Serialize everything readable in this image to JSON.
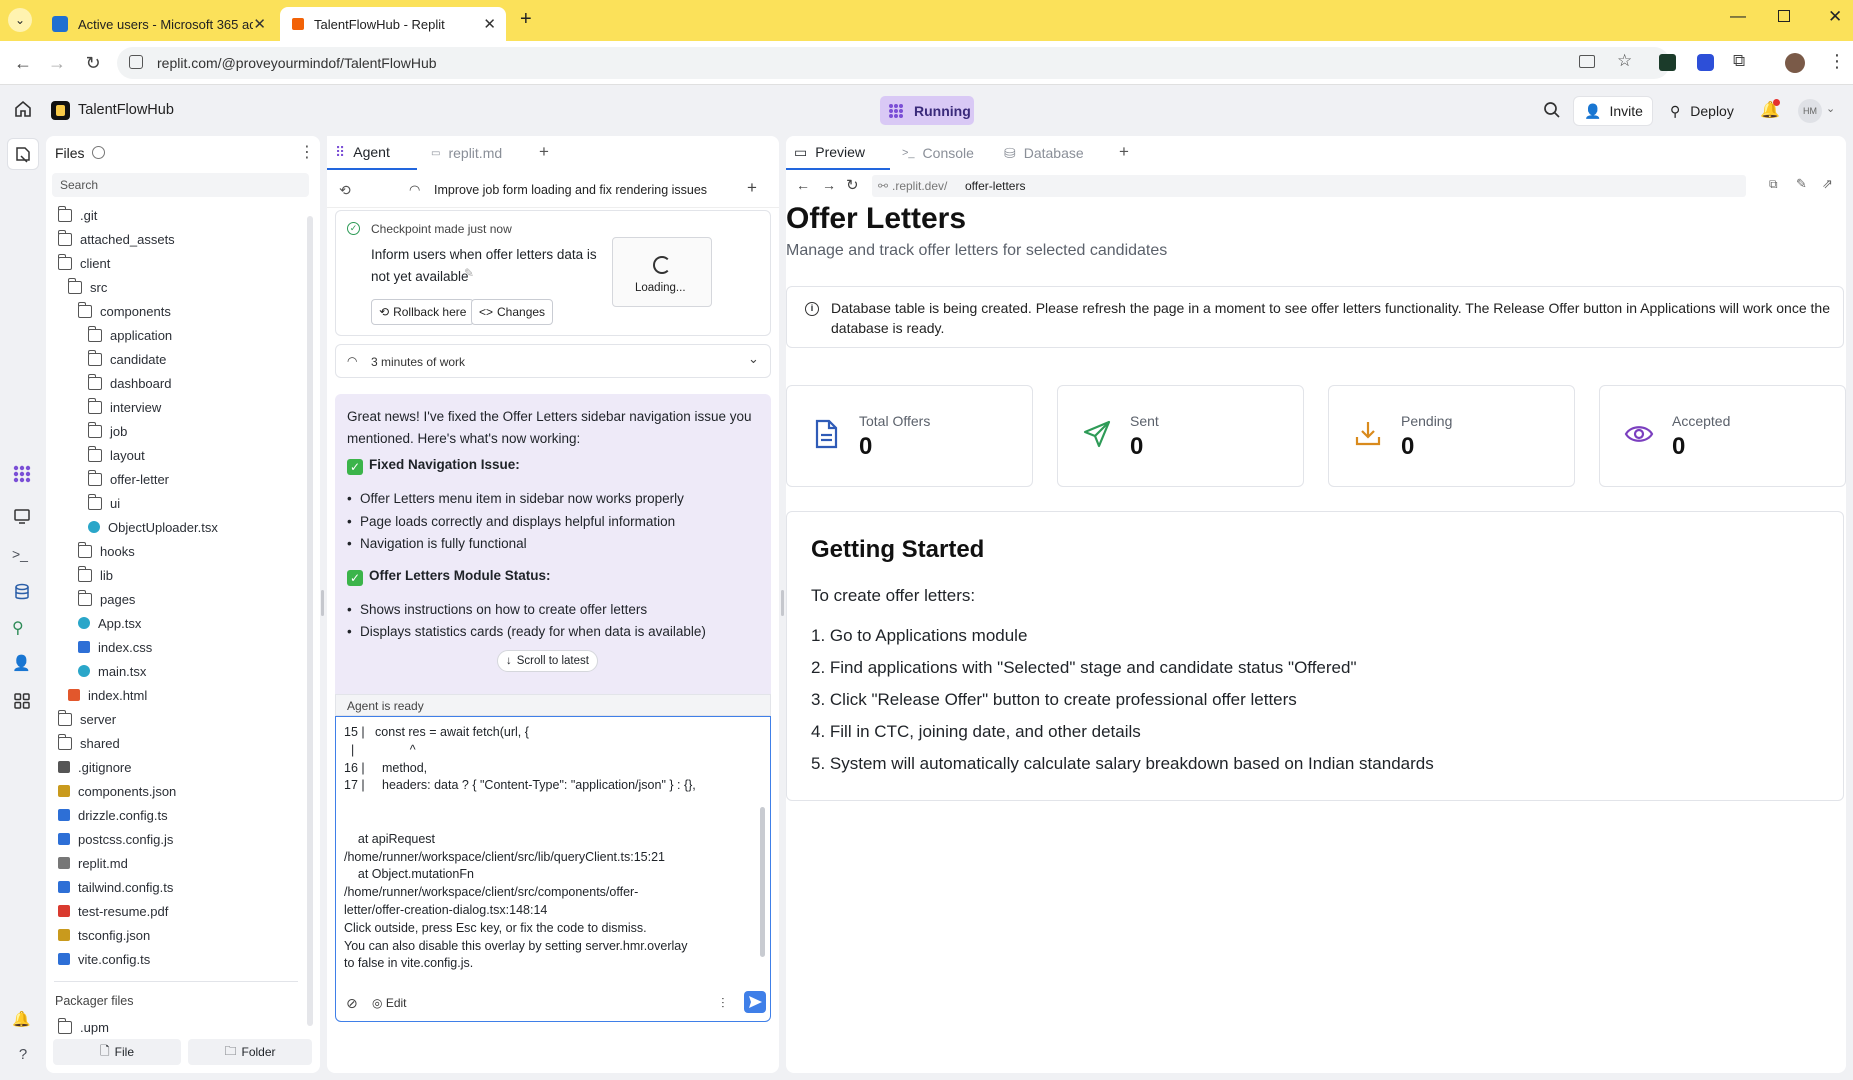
{
  "browser": {
    "tabs": [
      {
        "title": "Active users - Microsoft 365 ad",
        "active": false
      },
      {
        "title": "TalentFlowHub - Replit",
        "active": true
      }
    ],
    "url": "replit.com/@proveyourmindof/TalentFlowHub"
  },
  "header": {
    "project_name": "TalentFlowHub",
    "status": "Running",
    "invite_label": "Invite",
    "deploy_label": "Deploy",
    "avatar_initials": "HM"
  },
  "files": {
    "title": "Files",
    "search_placeholder": "Search",
    "tree": [
      {
        "name": ".git",
        "type": "folder",
        "depth": 0
      },
      {
        "name": "attached_assets",
        "type": "folder",
        "depth": 0
      },
      {
        "name": "client",
        "type": "folder",
        "depth": 0
      },
      {
        "name": "src",
        "type": "folder",
        "depth": 1
      },
      {
        "name": "components",
        "type": "folder",
        "depth": 2
      },
      {
        "name": "application",
        "type": "folder",
        "depth": 3
      },
      {
        "name": "candidate",
        "type": "folder",
        "depth": 3
      },
      {
        "name": "dashboard",
        "type": "folder",
        "depth": 3
      },
      {
        "name": "interview",
        "type": "folder",
        "depth": 3
      },
      {
        "name": "job",
        "type": "folder",
        "depth": 3
      },
      {
        "name": "layout",
        "type": "folder",
        "depth": 3
      },
      {
        "name": "offer-letter",
        "type": "folder",
        "depth": 3
      },
      {
        "name": "ui",
        "type": "folder",
        "depth": 3
      },
      {
        "name": "ObjectUploader.tsx",
        "type": "react",
        "depth": 3
      },
      {
        "name": "hooks",
        "type": "folder",
        "depth": 2
      },
      {
        "name": "lib",
        "type": "folder",
        "depth": 2
      },
      {
        "name": "pages",
        "type": "folder",
        "depth": 2
      },
      {
        "name": "App.tsx",
        "type": "react",
        "depth": 2
      },
      {
        "name": "index.css",
        "type": "css",
        "depth": 2
      },
      {
        "name": "main.tsx",
        "type": "react",
        "depth": 2
      },
      {
        "name": "index.html",
        "type": "html",
        "depth": 1
      },
      {
        "name": "server",
        "type": "folder",
        "depth": 0
      },
      {
        "name": "shared",
        "type": "folder",
        "depth": 0
      },
      {
        "name": ".gitignore",
        "type": "file",
        "depth": 0
      },
      {
        "name": "components.json",
        "type": "json",
        "depth": 0
      },
      {
        "name": "drizzle.config.ts",
        "type": "ts",
        "depth": 0
      },
      {
        "name": "postcss.config.js",
        "type": "js",
        "depth": 0
      },
      {
        "name": "replit.md",
        "type": "md",
        "depth": 0
      },
      {
        "name": "tailwind.config.ts",
        "type": "ts",
        "depth": 0
      },
      {
        "name": "test-resume.pdf",
        "type": "pdf",
        "depth": 0
      },
      {
        "name": "tsconfig.json",
        "type": "json",
        "depth": 0
      },
      {
        "name": "vite.config.ts",
        "type": "ts",
        "depth": 0
      }
    ],
    "packager_title": "Packager files",
    "packager_items": [
      ".upm"
    ],
    "new_file_label": "File",
    "new_folder_label": "Folder"
  },
  "agent": {
    "tabs": [
      "Agent",
      "replit.md"
    ],
    "task_title": "Improve job form loading and fix rendering issues",
    "checkpoint_label": "Checkpoint made just now",
    "checkpoint_text": "Inform users when offer letters data is not yet available",
    "loading_label": "Loading...",
    "rollback_label": "Rollback here",
    "changes_label": "Changes",
    "work_duration": "3 minutes of work",
    "message_intro": "Great news! I've fixed the Offer Letters sidebar navigation issue you mentioned. Here's what's now working:",
    "section1_title": "Fixed Navigation Issue:",
    "section1_items": [
      "Offer Letters menu item in sidebar now works properly",
      "Page loads correctly and displays helpful information",
      "Navigation is fully functional"
    ],
    "section2_title": "Offer Letters Module Status:",
    "section2_items": [
      "Shows instructions on how to create offer letters",
      "Displays statistics cards (ready for when data is available)"
    ],
    "scroll_to_latest": "Scroll to latest",
    "ready_status": "Agent is ready",
    "input_lines": [
      "15 |   const res = await fetch(url, {",
      "  |                ^",
      "16 |     method,",
      "17 |     headers: data ? { \"Content-Type\": \"application/json\" } : {},",
      "",
      "",
      "    at apiRequest",
      "/home/runner/workspace/client/src/lib/queryClient.ts:15:21",
      "    at Object.mutationFn",
      "/home/runner/workspace/client/src/components/offer-",
      "letter/offer-creation-dialog.tsx:148:14",
      "Click outside, press Esc key, or fix the code to dismiss.",
      "You can also disable this overlay by setting server.hmr.overlay",
      "to false in vite.config.js."
    ],
    "edit_label": "Edit"
  },
  "preview": {
    "tabs": [
      "Preview",
      "Console",
      "Database"
    ],
    "url_prefix": ".replit.dev/",
    "url_path": "offer-letters",
    "page_title": "Offer Letters",
    "page_subtitle": "Manage and track offer letters for selected candidates",
    "alert": "Database table is being created. Please refresh the page in a moment to see offer letters functionality. The Release Offer button in Applications will work once the database is ready.",
    "stats": [
      {
        "label": "Total Offers",
        "value": "0",
        "icon": "file-text-icon",
        "color": "#2f5bb7"
      },
      {
        "label": "Sent",
        "value": "0",
        "icon": "send-icon",
        "color": "#2e9b57"
      },
      {
        "label": "Pending",
        "value": "0",
        "icon": "download-icon",
        "color": "#d98a1c"
      },
      {
        "label": "Accepted",
        "value": "0",
        "icon": "eye-icon",
        "color": "#7b3fbf"
      }
    ],
    "getting_started_title": "Getting Started",
    "getting_started_intro": "To create offer letters:",
    "steps": [
      "1. Go to Applications module",
      "2. Find applications with \"Selected\" stage and candidate status \"Offered\"",
      "3. Click \"Release Offer\" button to create professional offer letters",
      "4. Fill in CTC, joining date, and other details",
      "5. System will automatically calculate salary breakdown based on Indian standards"
    ]
  },
  "colors": {
    "browser_tab_bar": "#fbe15a",
    "running_badge": "#d9c9f5",
    "agent_message_bg": "#eeeaf8",
    "send_button": "#3f7fe8"
  }
}
